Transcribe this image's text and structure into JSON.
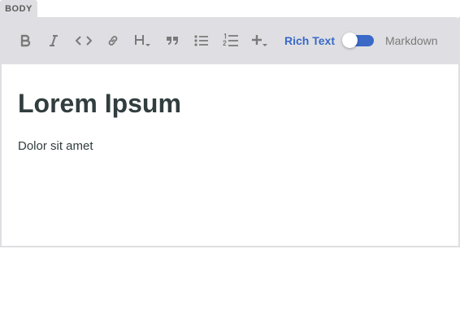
{
  "field": {
    "label": "BODY"
  },
  "toolbar": {
    "buttons": [
      {
        "name": "bold",
        "icon": "bold-icon"
      },
      {
        "name": "italic",
        "icon": "italic-icon"
      },
      {
        "name": "code",
        "icon": "code-icon"
      },
      {
        "name": "link",
        "icon": "link-icon"
      },
      {
        "name": "heading",
        "icon": "heading-dropdown-icon"
      },
      {
        "name": "quote",
        "icon": "quote-icon"
      },
      {
        "name": "bulleted-list",
        "icon": "bulleted-list-icon"
      },
      {
        "name": "numbered-list",
        "icon": "numbered-list-icon"
      },
      {
        "name": "add",
        "icon": "plus-dropdown-icon"
      }
    ],
    "mode_toggle": {
      "rich_text_label": "Rich Text",
      "markdown_label": "Markdown",
      "active_mode": "Rich Text"
    }
  },
  "document": {
    "heading": "Lorem Ipsum",
    "paragraph": "Dolor sit amet"
  },
  "colors": {
    "accent": "#3a69c7",
    "toolbar_bg": "#dfdfe3",
    "icon": "#7a7a7a",
    "text": "#313d3e"
  }
}
